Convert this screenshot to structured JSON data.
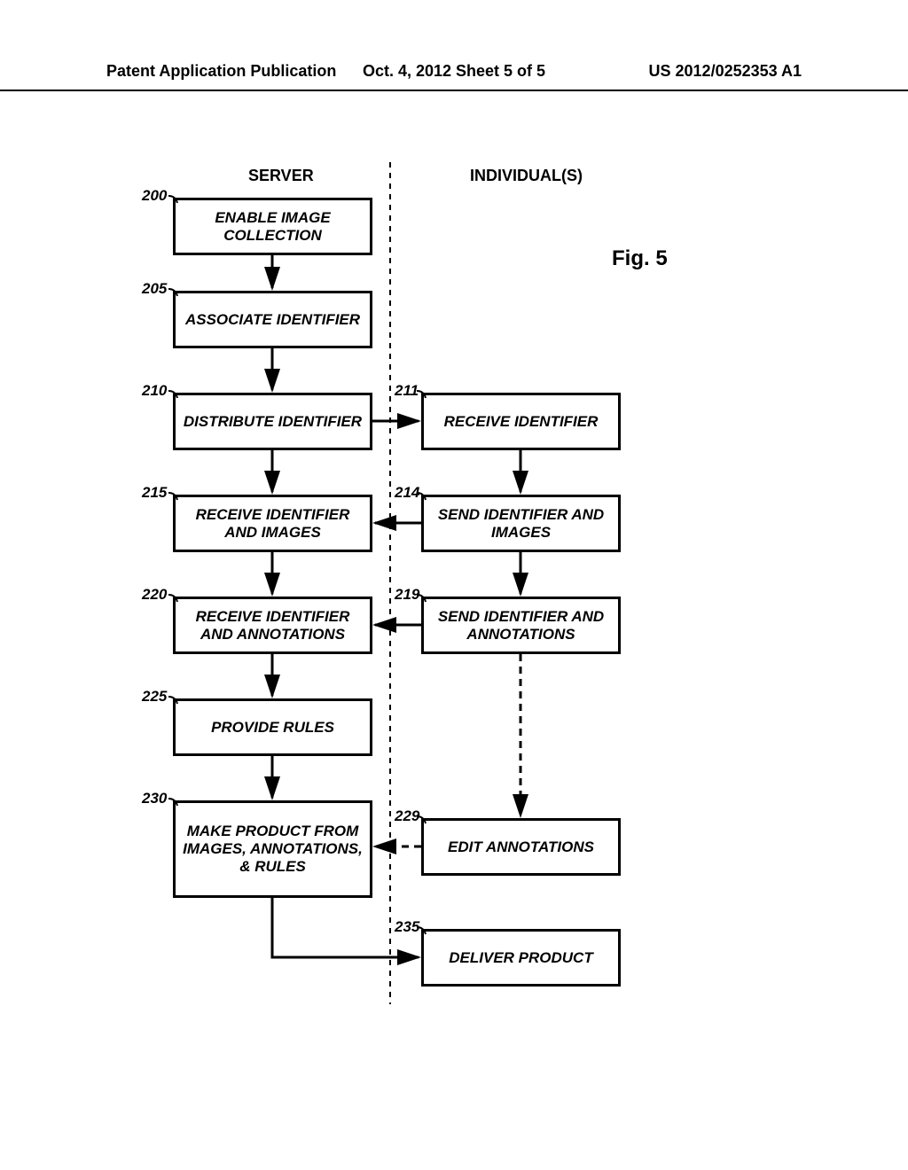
{
  "header": {
    "left": "Patent Application Publication",
    "center": "Oct. 4, 2012   Sheet 5 of 5",
    "right": "US 2012/0252353 A1"
  },
  "columns": {
    "server": "SERVER",
    "individuals": "INDIVIDUAL(S)"
  },
  "figure_label": "Fig. 5",
  "boxes": {
    "b200": {
      "ref": "200",
      "text": "ENABLE IMAGE COLLECTION"
    },
    "b205": {
      "ref": "205",
      "text": "ASSOCIATE IDENTIFIER"
    },
    "b210": {
      "ref": "210",
      "text": "DISTRIBUTE IDENTIFIER"
    },
    "b211": {
      "ref": "211",
      "text": "RECEIVE IDENTIFIER"
    },
    "b215": {
      "ref": "215",
      "text": "RECEIVE IDENTIFIER AND IMAGES"
    },
    "b214": {
      "ref": "214",
      "text": "SEND IDENTIFIER AND IMAGES"
    },
    "b220": {
      "ref": "220",
      "text": "RECEIVE IDENTIFIER AND ANNOTATIONS"
    },
    "b219": {
      "ref": "219",
      "text": "SEND IDENTIFIER AND ANNOTATIONS"
    },
    "b225": {
      "ref": "225",
      "text": "PROVIDE RULES"
    },
    "b230": {
      "ref": "230",
      "text": "MAKE PRODUCT FROM IMAGES, ANNOTATIONS, & RULES"
    },
    "b229": {
      "ref": "229",
      "text": "EDIT ANNOTATIONS"
    },
    "b235": {
      "ref": "235",
      "text": "DELIVER PRODUCT"
    }
  }
}
